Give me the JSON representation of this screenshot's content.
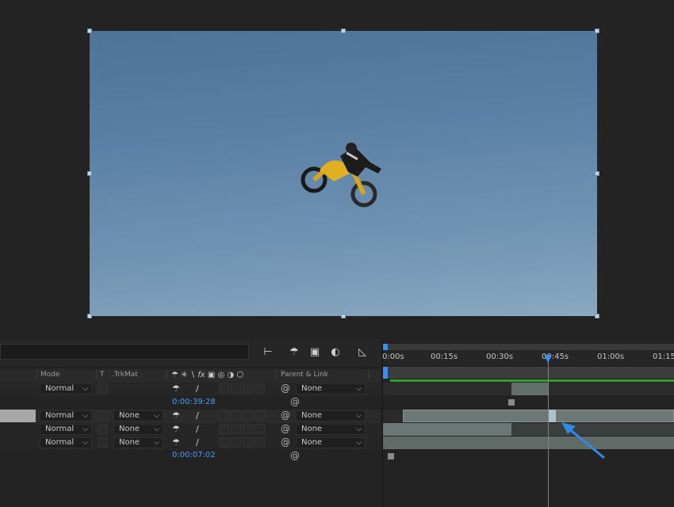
{
  "viewer": {
    "footage_subject": "motocross-rider-mid-air"
  },
  "toolbar": {
    "icons": [
      "composition-flowchart-icon",
      "draft-3d-icon",
      "frame-blending-icon",
      "motion-blur-icon",
      "graph-editor-icon"
    ]
  },
  "columns": {
    "mode": "Mode",
    "t": "T",
    "trkmat": ".TrkMat",
    "parent_link": "Parent & Link"
  },
  "layers": [
    {
      "mode": "Normal",
      "trkmat": "",
      "parent": "None",
      "timecode": "0:00:39:28"
    },
    {
      "mode": "Normal",
      "trkmat": "None",
      "parent": "None"
    },
    {
      "mode": "Normal",
      "trkmat": "None",
      "parent": "None"
    },
    {
      "mode": "Normal",
      "trkmat": "None",
      "parent": "None",
      "timecode": "0:00:07:02"
    }
  ],
  "timeline": {
    "ticks": [
      "0:00s",
      "00:15s",
      "00:30s",
      "00:45s",
      "01:00s",
      "01:15"
    ],
    "playhead_time": "00:45s"
  },
  "colors": {
    "accent": "#3a8ef0",
    "timecode": "#4b9cf0",
    "work_area": "#2fa02f"
  }
}
